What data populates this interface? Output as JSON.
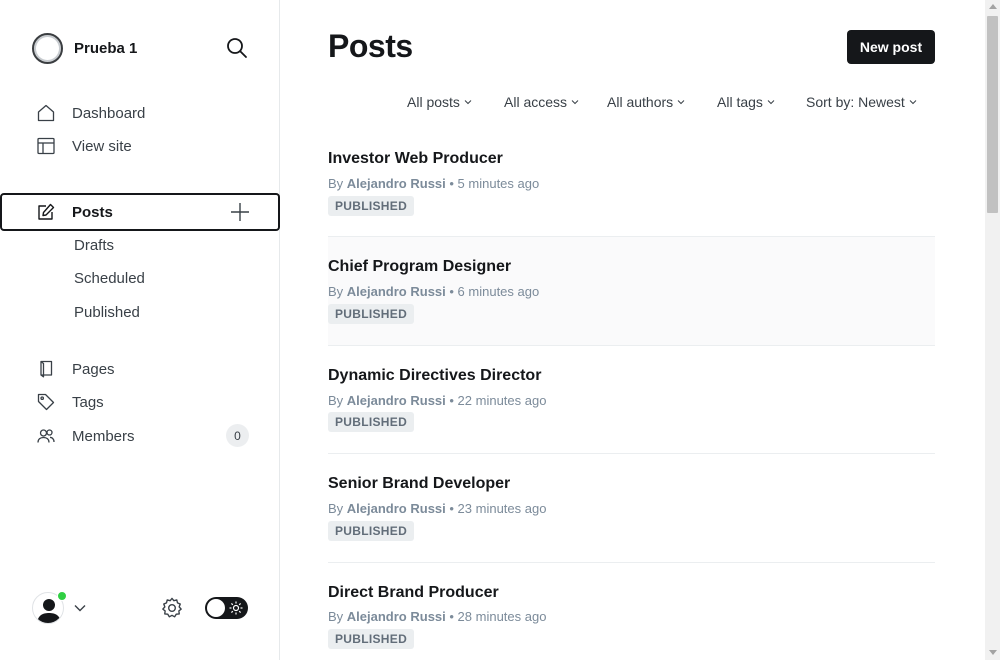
{
  "sidebar": {
    "site_name": "Prueba 1",
    "nav": {
      "dashboard": "Dashboard",
      "view_site": "View site",
      "posts": "Posts",
      "drafts": "Drafts",
      "scheduled": "Scheduled",
      "published": "Published",
      "pages": "Pages",
      "tags": "Tags",
      "members": "Members",
      "members_count": "0"
    },
    "icons": [
      "search-icon",
      "home-icon",
      "layout-icon",
      "pencil-icon",
      "plus-icon",
      "page-icon",
      "tag-icon",
      "members-icon",
      "user-avatar",
      "chevron-down-icon",
      "gear-icon",
      "sun-icon"
    ],
    "online_color": "#30cf43"
  },
  "main": {
    "title": "Posts",
    "new_post_label": "New post",
    "filters": {
      "type": "All posts",
      "access": "All access",
      "authors": "All authors",
      "tags": "All tags",
      "sort": "Sort by: Newest"
    },
    "posts": [
      {
        "title": "Investor Web Producer",
        "by": "By",
        "author": "Alejandro Russi",
        "time": "• 5 minutes ago",
        "status": "PUBLISHED"
      },
      {
        "title": "Chief Program Designer",
        "by": "By",
        "author": "Alejandro Russi",
        "time": "• 6 minutes ago",
        "status": "PUBLISHED"
      },
      {
        "title": "Dynamic Directives Director",
        "by": "By",
        "author": "Alejandro Russi",
        "time": "• 22 minutes ago",
        "status": "PUBLISHED"
      },
      {
        "title": "Senior Brand Developer",
        "by": "By",
        "author": "Alejandro Russi",
        "time": "• 23 minutes ago",
        "status": "PUBLISHED"
      },
      {
        "title": "Direct Brand Producer",
        "by": "By",
        "author": "Alejandro Russi",
        "time": "• 28 minutes ago",
        "status": "PUBLISHED"
      }
    ]
  },
  "colors": {
    "primary": "#15171a",
    "muted": "#7c8b9a",
    "badge_bg": "#ebeef0"
  }
}
